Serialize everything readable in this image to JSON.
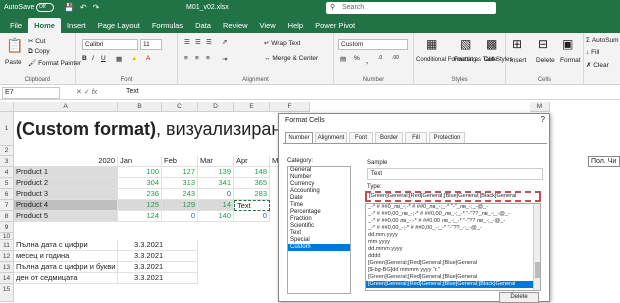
{
  "titlebar": {
    "autosave": "AutoSave",
    "toggle": "Off",
    "filename": "M01_v02.xlsx",
    "search_placeholder": "Search"
  },
  "tabs": [
    "File",
    "Home",
    "Insert",
    "Page Layout",
    "Formulas",
    "Data",
    "Review",
    "View",
    "Help",
    "Power Pivot"
  ],
  "ribbon": {
    "paste": "Paste",
    "cut": "Cut",
    "copy": "Copy",
    "format_painter": "Format Painter",
    "clipboard": "Clipboard",
    "font_name": "Calibri",
    "font_size": "11",
    "font_group": "Font",
    "wrap_text": "Wrap Text",
    "merge_center": "Merge & Center",
    "alignment": "Alignment",
    "number_format": "Custom",
    "number": "Number",
    "conditional_formatting": "Conditional Formatting",
    "format_as_table": "Format as Table",
    "cell_styles": "Cell Styles",
    "styles": "Styles",
    "insert": "Insert",
    "delete": "Delete",
    "format": "Format",
    "cells": "Cells",
    "autosum": "AutoSum",
    "fill": "Fill",
    "clear": "Clear"
  },
  "formula_bar": {
    "name_box": "E7",
    "content": "Text"
  },
  "columns": [
    "A",
    "B",
    "C",
    "D",
    "E",
    "F",
    "M"
  ],
  "rows": [
    "1",
    "2",
    "3",
    "4",
    "5",
    "6",
    "7",
    "8",
    "9",
    "10",
    "11",
    "12",
    "13",
    "14",
    "15"
  ],
  "sheet": {
    "title_bold": "(Custom format)",
    "title_rest": ", визуализиране на",
    "year": "2020",
    "months": [
      "Jan",
      "Feb",
      "Mar",
      "Apr",
      "Ma"
    ],
    "products": [
      "Product 1",
      "Product 2",
      "Product 3",
      "Product 4",
      "Product 5"
    ],
    "b": [
      "100",
      "304",
      "236",
      "125",
      "124"
    ],
    "c": [
      "127",
      "313",
      "243",
      "129",
      "0"
    ],
    "d": [
      "139",
      "341",
      "0",
      "14",
      "140"
    ],
    "e": [
      "148",
      "365",
      "283",
      "Text",
      "0"
    ],
    "labels": [
      "Пълна дата с цифри",
      "месец и година",
      "Пълна дата с цифри и букви",
      "ден от седмицата"
    ],
    "dates": [
      "3.3.2021",
      "3.3.2021",
      "3.3.2021",
      "3.3.2021"
    ],
    "right_header": "Пол. Чи"
  },
  "dialog": {
    "title": "Format Cells",
    "close": "?",
    "tabs": [
      "Number",
      "Alignment",
      "Font",
      "Border",
      "Fill",
      "Protection"
    ],
    "category_label": "Category:",
    "categories": [
      "General",
      "Number",
      "Currency",
      "Accounting",
      "Date",
      "Time",
      "Percentage",
      "Fraction",
      "Scientific",
      "Text",
      "Special",
      "Custom"
    ],
    "sample_label": "Sample",
    "sample_value": "Text",
    "type_label": "Type:",
    "type_value": "[Green]General;[Red]General;[Blue]General;[Black]General",
    "type_list": [
      "_-* # ##0_лв_-;-* # ##0_лв_-;_-* \"-\"_лв_-;_-@_-",
      "_-* # ##0,00_лв_-;-* # ##0,00_лв_-;_-* \"-\"??_лв_-;_-@_-",
      "_-* # ##0,00 лв_-;-* # ##0,00 лв_-;_-* \"-\"?? лв_-;_-@_-",
      "_-* # ##0,00_-;-* # ##0,00_-;_-* \"-\"??_-;_-@_-",
      "dd.mm.yyyy",
      "mm.yyyy",
      "dd.mmm.yyyy",
      "dddd",
      "[Green]General;[Red]General;[Blue]General",
      "[$-bg-BG]dd mmmm yyyy \"г.\"",
      "[Green]General;[Red]General;[Blue]General",
      "[Green]General;[Red]General;[Blue]General;[Black]General"
    ],
    "delete_button": "Delete"
  }
}
